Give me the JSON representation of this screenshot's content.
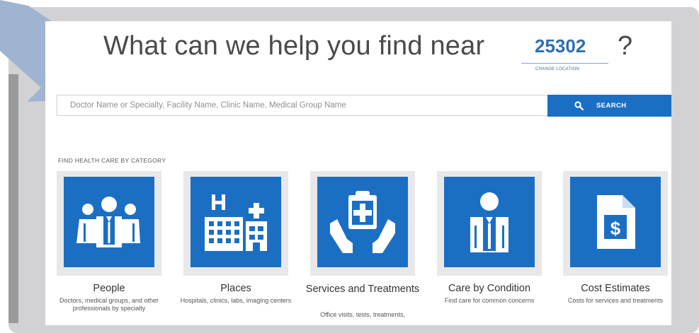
{
  "header": {
    "headline": "What can we help you find near",
    "zip": "25302",
    "question_mark": "?",
    "change_location": "CHANGE LOCATION"
  },
  "search": {
    "placeholder": "Doctor Name or Specialty, Facility Name, Clinic Name, Medical Group Name",
    "button_label": "SEARCH"
  },
  "categories": {
    "heading": "FIND HEALTH CARE BY CATEGORY",
    "items": [
      {
        "title": "People",
        "desc": "Doctors, medical groups, and other professionals by specialty",
        "icon": "people-icon"
      },
      {
        "title": "Places",
        "desc": "Hospitals, clinics, labs, imaging centers",
        "icon": "buildings-icon"
      },
      {
        "title": "Services and Treatments",
        "desc": "Office visits, tests, treatments,",
        "icon": "clipboard-hands-icon"
      },
      {
        "title": "Care by Condition",
        "desc": "Find care for common concerns",
        "icon": "doctor-icon"
      },
      {
        "title": "Cost Estimates",
        "desc": "Costs for services and treatments",
        "icon": "dollar-document-icon"
      }
    ]
  },
  "colors": {
    "accent": "#1b6fc3",
    "zip": "#2f6fb0",
    "frame": "#d2d2d4"
  }
}
